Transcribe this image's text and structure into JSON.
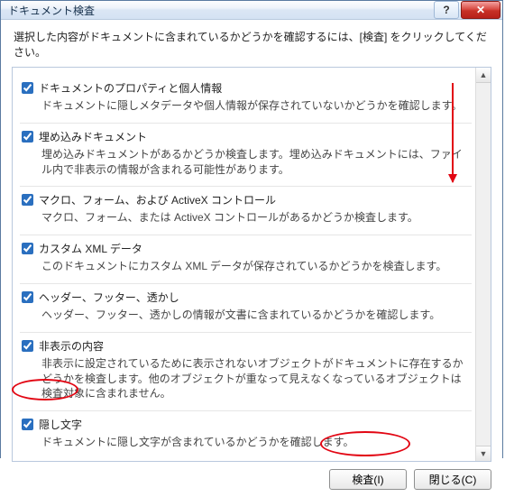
{
  "window": {
    "title": "ドキュメント検査",
    "help_symbol": "?",
    "close_symbol": "✕"
  },
  "instruction": "選択した内容がドキュメントに含まれているかどうかを確認するには、[検査] をクリックしてください。",
  "items": [
    {
      "title": "ドキュメントのプロパティと個人情報",
      "desc": "ドキュメントに隠しメタデータや個人情報が保存されていないかどうかを確認します。",
      "checked": true
    },
    {
      "title": "埋め込みドキュメント",
      "desc": "埋め込みドキュメントがあるかどうか検査します。埋め込みドキュメントには、ファイル内で非表示の情報が含まれる可能性があります。",
      "checked": true
    },
    {
      "title": "マクロ、フォーム、および ActiveX コントロール",
      "desc": "マクロ、フォーム、または ActiveX コントロールがあるかどうか検査します。",
      "checked": true
    },
    {
      "title": "カスタム XML データ",
      "desc": "このドキュメントにカスタム XML データが保存されているかどうかを検査します。",
      "checked": true
    },
    {
      "title": "ヘッダー、フッター、透かし",
      "desc": "ヘッダー、フッター、透かしの情報が文書に含まれているかどうかを確認します。",
      "checked": true
    },
    {
      "title": "非表示の内容",
      "desc": "非表示に設定されているために表示されないオブジェクトがドキュメントに存在するかどうかを検査します。他のオブジェクトが重なって見えなくなっているオブジェクトは検査対象に含まれません。",
      "checked": true
    },
    {
      "title": "隠し文字",
      "desc": "ドキュメントに隠し文字が含まれているかどうかを確認します。",
      "checked": true
    }
  ],
  "buttons": {
    "inspect": "検査(I)",
    "close": "閉じる(C)"
  },
  "scroll": {
    "up": "▲",
    "down": "▼"
  }
}
